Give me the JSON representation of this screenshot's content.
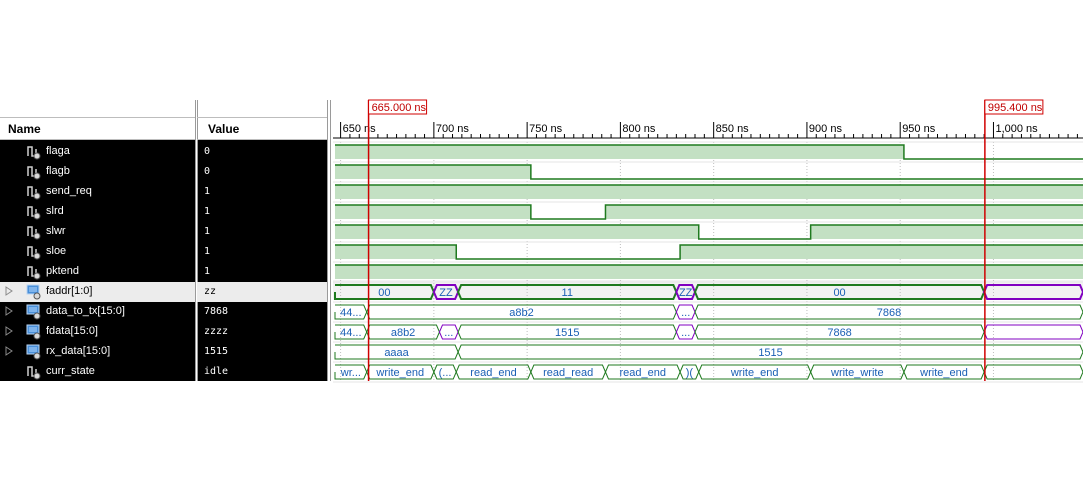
{
  "headers": {
    "name": "Name",
    "value": "Value"
  },
  "cursors": [
    {
      "label": "665.000 ns",
      "time": 665.0
    },
    {
      "label": "995.400 ns",
      "time": 995.4
    }
  ],
  "timeline": {
    "start": 647,
    "end": 1048,
    "ticks": [
      {
        "t": 650,
        "label": "650 ns"
      },
      {
        "t": 700,
        "label": "700 ns"
      },
      {
        "t": 750,
        "label": "750 ns"
      },
      {
        "t": 800,
        "label": "800 ns"
      },
      {
        "t": 850,
        "label": "850 ns"
      },
      {
        "t": 900,
        "label": "900 ns"
      },
      {
        "t": 950,
        "label": "950 ns"
      },
      {
        "t": 1000,
        "label": "1,000 ns"
      }
    ]
  },
  "colors": {
    "wave_green": "#1f7a1f",
    "fill_green": "#c3e0c3",
    "bus_purple": "#8000c0",
    "cursor_red": "#d00000"
  },
  "signals": [
    {
      "name": "flaga",
      "value": "0",
      "kind": "bit",
      "icon": "bit-signal-icon",
      "expandable": false,
      "wave": [
        [
          647,
          1
        ],
        [
          952,
          0
        ]
      ]
    },
    {
      "name": "flagb",
      "value": "0",
      "kind": "bit",
      "icon": "bit-signal-icon",
      "expandable": false,
      "wave": [
        [
          647,
          1
        ],
        [
          752,
          0
        ]
      ]
    },
    {
      "name": "send_req",
      "value": "1",
      "kind": "bit",
      "icon": "bit-signal-icon",
      "expandable": false,
      "wave": [
        [
          647,
          1
        ]
      ]
    },
    {
      "name": "slrd",
      "value": "1",
      "kind": "bit",
      "icon": "bit-signal-icon",
      "expandable": false,
      "wave": [
        [
          647,
          1
        ],
        [
          752,
          0
        ],
        [
          792,
          1
        ]
      ]
    },
    {
      "name": "slwr",
      "value": "1",
      "kind": "bit",
      "icon": "bit-signal-icon",
      "expandable": false,
      "wave": [
        [
          647,
          1
        ],
        [
          842,
          0
        ],
        [
          902,
          1
        ]
      ]
    },
    {
      "name": "sloe",
      "value": "1",
      "kind": "bit",
      "icon": "bit-signal-icon",
      "expandable": false,
      "wave": [
        [
          647,
          1
        ],
        [
          712,
          0
        ],
        [
          832,
          1
        ]
      ]
    },
    {
      "name": "pktend",
      "value": "1",
      "kind": "bit",
      "icon": "bit-signal-icon",
      "expandable": false,
      "wave": [
        [
          647,
          1
        ]
      ]
    },
    {
      "name": "faddr[1:0]",
      "value": "zz",
      "kind": "bus",
      "icon": "bus-signal-icon",
      "expandable": true,
      "selected": true,
      "segments": [
        {
          "from": 647,
          "to": 700,
          "label": "00"
        },
        {
          "from": 700,
          "to": 713,
          "label": "ZZ",
          "z": true
        },
        {
          "from": 713,
          "to": 830,
          "label": "11"
        },
        {
          "from": 830,
          "to": 840,
          "label": "ZZ",
          "z": true
        },
        {
          "from": 840,
          "to": 995,
          "label": "00"
        },
        {
          "from": 995,
          "to": 1048,
          "label": "",
          "z": true
        }
      ]
    },
    {
      "name": "data_to_tx[15:0]",
      "value": "7868",
      "kind": "bus",
      "icon": "bus-signal-icon",
      "expandable": true,
      "segments": [
        {
          "from": 647,
          "to": 664,
          "label": "44..."
        },
        {
          "from": 664,
          "to": 830,
          "label": "a8b2"
        },
        {
          "from": 830,
          "to": 840,
          "label": "...",
          "z": true
        },
        {
          "from": 840,
          "to": 1048,
          "label": "7868"
        }
      ]
    },
    {
      "name": "fdata[15:0]",
      "value": "zzzz",
      "kind": "bus",
      "icon": "bus-signal-icon",
      "expandable": true,
      "segments": [
        {
          "from": 647,
          "to": 664,
          "label": "44..."
        },
        {
          "from": 664,
          "to": 703,
          "label": "a8b2"
        },
        {
          "from": 703,
          "to": 713,
          "label": "...",
          "z": true
        },
        {
          "from": 713,
          "to": 830,
          "label": "1515"
        },
        {
          "from": 830,
          "to": 840,
          "label": "...",
          "z": true
        },
        {
          "from": 840,
          "to": 995,
          "label": "7868"
        },
        {
          "from": 995,
          "to": 1048,
          "label": "",
          "z": true
        }
      ]
    },
    {
      "name": "rx_data[15:0]",
      "value": "1515",
      "kind": "bus",
      "icon": "bus-signal-icon",
      "expandable": true,
      "segments": [
        {
          "from": 647,
          "to": 713,
          "label": "aaaa"
        },
        {
          "from": 713,
          "to": 1048,
          "label": "1515"
        }
      ]
    },
    {
      "name": "curr_state",
      "value": "idle",
      "kind": "bus",
      "icon": "bit-signal-icon",
      "expandable": false,
      "segments": [
        {
          "from": 647,
          "to": 664,
          "label": "wr..."
        },
        {
          "from": 664,
          "to": 700,
          "label": "write_end"
        },
        {
          "from": 700,
          "to": 712,
          "label": "(..."
        },
        {
          "from": 712,
          "to": 752,
          "label": "read_end"
        },
        {
          "from": 752,
          "to": 792,
          "label": "read_read"
        },
        {
          "from": 792,
          "to": 832,
          "label": "read_end"
        },
        {
          "from": 832,
          "to": 842,
          "label": ")("
        },
        {
          "from": 842,
          "to": 902,
          "label": "write_end"
        },
        {
          "from": 902,
          "to": 952,
          "label": "write_write"
        },
        {
          "from": 952,
          "to": 995,
          "label": "write_end"
        },
        {
          "from": 995,
          "to": 1048,
          "label": ""
        }
      ]
    }
  ]
}
